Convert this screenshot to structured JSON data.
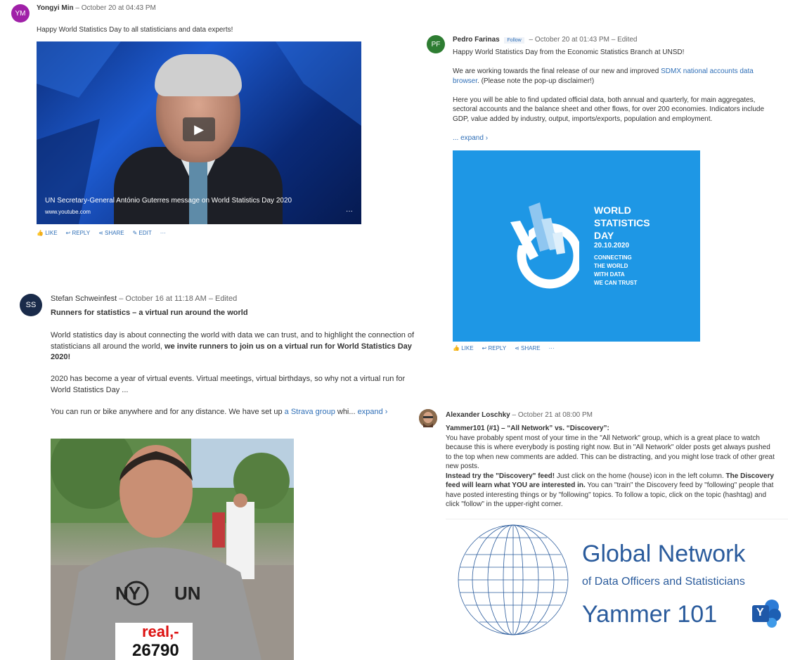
{
  "post1": {
    "avatar_initials": "YM",
    "author": "Yongyi Min",
    "meta": "– October 20 at 04:43 PM",
    "body": "Happy World Statistics Day to all statisticians and data experts!",
    "video_caption": "UN Secretary-General António Guterres message on World Statistics Day 2020",
    "video_source": "www.youtube.com",
    "video_more": "···",
    "actions": [
      "LIKE",
      "REPLY",
      "SHARE",
      "EDIT",
      "···"
    ]
  },
  "post2": {
    "avatar_initials": "PF",
    "author": "Pedro Farinas",
    "follow_label": "Follow",
    "meta": "– October 20 at 01:43 PM – Edited",
    "line1": "Happy World Statistics Day from the Economic Statistics Branch at UNSD!",
    "para2_a": "We are working towards the final release of our new and improved ",
    "para2_link": "SDMX national accounts data browser",
    "para2_b": ". (Please note the pop-up disclaimer!)",
    "para3": "Here you will be able to find updated official data, both annual and quarterly, for main aggregates, sectoral accounts and the balance sheet and other flows, for over 200 economies. Indicators include GDP, value added by industry, output, imports/exports, population and employment.",
    "expand": "... expand ›",
    "image_title": [
      "WORLD",
      "STATISTICS",
      "DAY"
    ],
    "image_date": "20.10.2020",
    "image_tagline": [
      "CONNECTING",
      "THE WORLD",
      "WITH DATA",
      "WE CAN TRUST"
    ],
    "actions": [
      "LIKE",
      "REPLY",
      "SHARE",
      "···"
    ]
  },
  "post3": {
    "avatar_initials": "SS",
    "author": "Stefan Schweinfest",
    "meta": "– October 16 at 11:18 AM – Edited",
    "title": "Runners for statistics – a virtual run around the world",
    "p1_a": "World statistics day is about connecting the world with data we can trust, and to highlight the connection of statisticians all around the world, ",
    "p1_bold": "we invite runners to join us on a virtual run for World Statistics Day 2020!",
    "p2_a": "2020 has become a year of virtual events. Virtual meetings, virtual birthdays, so why not a virtual run for",
    "p2_b": "World Statistics Day ...",
    "p3_a": "You can run or bike anywhere and for any distance. We have set up ",
    "p3_link": "a Strava group",
    "p3_b": " whi... ",
    "expand": "expand ›",
    "shirt_text_left": "NY",
    "shirt_text_right": "UN",
    "bib_brand": "real,-",
    "bib_number": "26790"
  },
  "post4": {
    "author": "Alexander Loschky",
    "meta": "– October 21 at 08:00 PM",
    "title": "Yammer101 (#1) – “All Network” vs. “Discovery”:",
    "p1": "You have probably spent most of your time in the \"All Network\" group, which is a great place to watch because this is where everybody is posting right now. But in \"All Network\" older posts get always pushed to the top when new comments are added. This can be distracting, and you might lose track of other great new posts.",
    "p2_bold1": "Instead try the \"Discovery\" feed!",
    "p2_a": " Just click on the home (house) icon in the left column. ",
    "p2_bold2": "The Discovery feed will learn what YOU are interested in.",
    "p2_b": " You can \"train\" the Discovery feed by \"following\" people that have posted interesting things or by \"following\" topics.  To follow a topic, click on the topic (hashtag) and click \"follow\" in the upper-right corner.",
    "image_line1": "Global Network",
    "image_line2": "of Data Officers and Statisticians",
    "image_line3": "Yammer 101",
    "image_logo_letter": "Y"
  },
  "colors": {
    "link": "#2f6fb7",
    "wsd_blue": "#1e97e5",
    "gn_blue": "#2a5b9c",
    "avatar_ym": "#a020a8",
    "avatar_pf": "#2e7d32",
    "avatar_ss": "#1a2b4a"
  }
}
